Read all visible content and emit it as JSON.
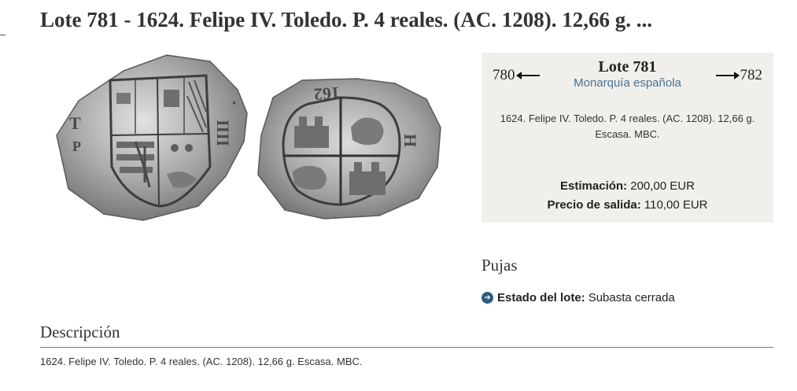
{
  "page": {
    "title": "Lote 781 - 1624. Felipe IV. Toledo. P. 4 reales. (AC. 1208). 12,66 g. ..."
  },
  "coin_image": {
    "obverse_letters": [
      "T",
      "P",
      "·",
      "IIII"
    ],
    "reverse_letters": [
      "162",
      "H"
    ]
  },
  "lot_box": {
    "prev_lot": "780",
    "next_lot": "782",
    "title": "Lote 781",
    "category": "Monarquía española",
    "summary": "1624. Felipe IV. Toledo. P. 4 reales. (AC. 1208). 12,66 g. Escasa. MBC.",
    "estimate_label": "Estimación:",
    "estimate_value": "200,00 EUR",
    "start_label": "Precio de salida:",
    "start_value": "110,00 EUR",
    "bg_color": "#f0efec",
    "accent_color": "#4a7294"
  },
  "bids": {
    "heading": "Pujas",
    "status_icon": "arrow-right-circle-icon",
    "status_label": "Estado del lote:",
    "status_value": "Subasta cerrada"
  },
  "description": {
    "heading": "Descripción",
    "text": "1624. Felipe IV. Toledo. P. 4 reales. (AC. 1208). 12,66 g. Escasa. MBC."
  }
}
